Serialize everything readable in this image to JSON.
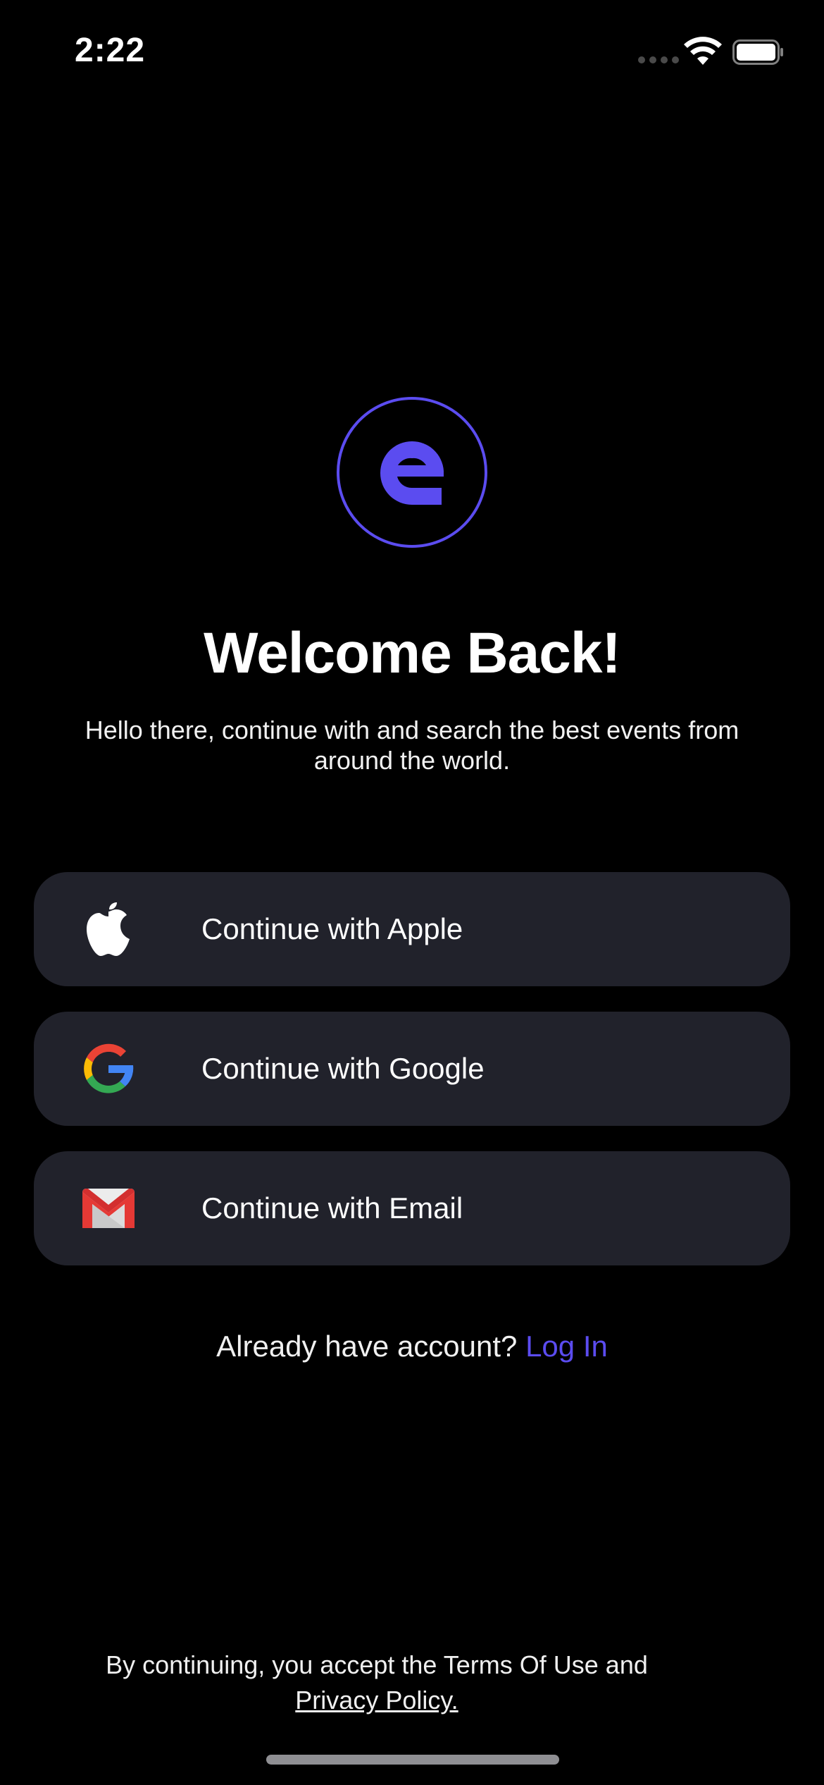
{
  "status_bar": {
    "time": "2:22"
  },
  "brand": {
    "accent_color": "#5b4cf0",
    "logo_icon": "e-logo-icon"
  },
  "header": {
    "title": "Welcome Back!",
    "subtitle": "Hello there, continue with and search the best events from around the world."
  },
  "auth_buttons": [
    {
      "label": "Continue with Apple",
      "icon": "apple-icon"
    },
    {
      "label": "Continue with Google",
      "icon": "google-icon"
    },
    {
      "label": "Continue with Email",
      "icon": "gmail-icon"
    }
  ],
  "login": {
    "prompt": "Already have account?",
    "link_label": "Log In"
  },
  "footer": {
    "text": "By continuing, you accept the Terms Of Use and",
    "privacy_label": "Privacy Policy."
  }
}
